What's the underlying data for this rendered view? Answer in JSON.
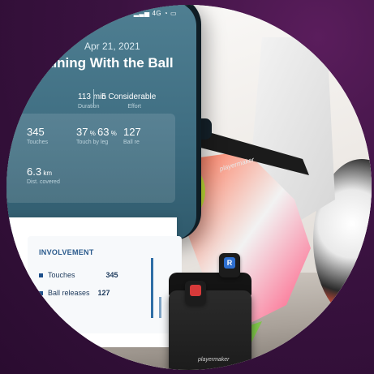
{
  "phone": {
    "status": "4G",
    "date": "Apr 21, 2021",
    "title": "aining With the Ball",
    "duration_value": "113 min",
    "duration_label": "Duration",
    "effort_value": "5 Considerable",
    "effort_label": "Effort",
    "touches_value": "345",
    "touches_label": "Touches",
    "touch_by_leg_a": "37",
    "touch_by_leg_b": "63",
    "touch_by_leg_label": "Touch by leg",
    "ball_releases_value": "127",
    "ball_releases_label": "Ball re",
    "distance_value": "6.3",
    "distance_unit": "km",
    "distance_label": "Dist. covered"
  },
  "involvement": {
    "heading": "INVOLVEMENT",
    "rows": [
      {
        "label": "Touches",
        "value": "345"
      },
      {
        "label": "Ball releases",
        "value": "127"
      }
    ]
  },
  "product": {
    "brand": "playermaker",
    "sensor_right_letter": "R",
    "colors": {
      "accent_blue": "#2e6fd0",
      "accent_red": "#d73a3a",
      "frame_purple": "#3a1240"
    }
  }
}
